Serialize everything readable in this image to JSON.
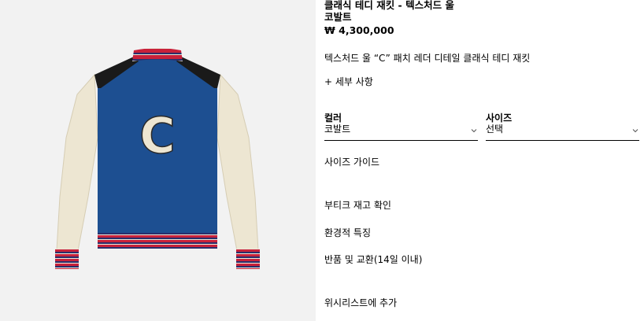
{
  "product": {
    "title_line1": "클래식 테디 재킷 - 텍스처드 울",
    "title_line2": "코발트",
    "price": "₩ 4,300,000",
    "description": "텍스처드 울 “C” 패치 레더 디테일 클래식 테디 재킷",
    "details_link": "+ 세부 사항"
  },
  "options": {
    "color": {
      "label": "컬러",
      "value": "코발트"
    },
    "size": {
      "label": "사이즈",
      "value": "선택"
    }
  },
  "links": {
    "size_guide": "사이즈 가이드",
    "boutique_stock": "부티크 재고 확인",
    "environmental": "환경적 특징",
    "returns": "반품 및 교환(14일 이내)",
    "wishlist": "위시리스트에 추가"
  },
  "image": {
    "patch_letter": "C"
  },
  "colors": {
    "image_background": "#f2f2f2",
    "body_blue": "#1d4f91",
    "sleeve_cream": "#ede6d2",
    "leather_black": "#1a1a1a",
    "rib_red": "#c8213a",
    "rib_navy": "#2a2f6b"
  }
}
